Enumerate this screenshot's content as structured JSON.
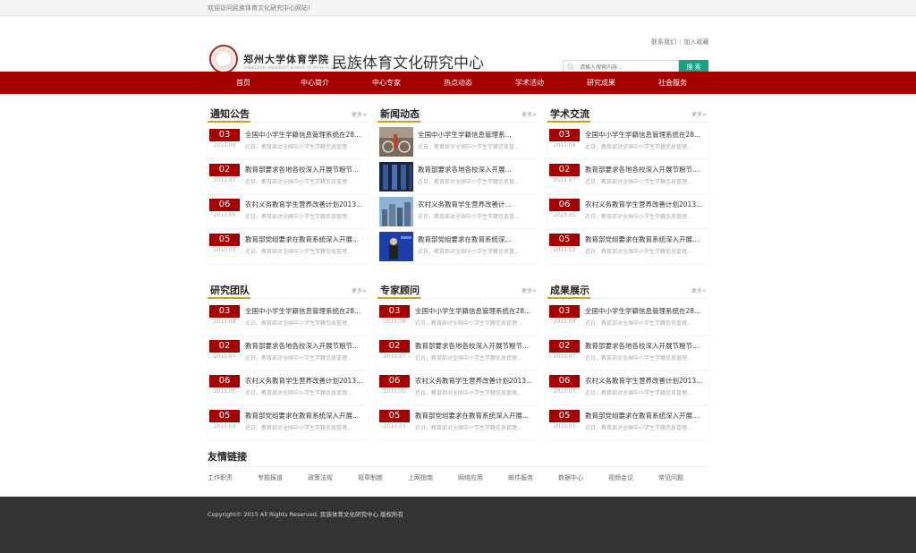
{
  "topbar": {
    "welcome": "欢迎访问民族体育文化研究中心网站!"
  },
  "header": {
    "logo_calligraphy": "郑州大学体育学院",
    "logo_sub": "ZHENGZHOU UNIVERSITY SCHOOL OF PHYSICAL EDUCATION",
    "site_title": "民族体育文化研究中心",
    "contact": "联系我们",
    "favorite": "加入收藏",
    "search_placeholder": "请输入搜索内容...",
    "search_button": "搜 索"
  },
  "nav": [
    "首页",
    "中心简介",
    "中心专家",
    "热点动态",
    "学术活动",
    "研究成果",
    "社会服务"
  ],
  "more_label": "更多>",
  "sections": [
    {
      "title": "通知公告",
      "items": [
        {
          "day": "03",
          "ym": "2013.09",
          "title": "全国中小学生学籍信息管理系统在28...",
          "desc": "近日，教育部对全国中小学生学籍信息管理..."
        },
        {
          "day": "02",
          "ym": "2013.07",
          "title": "教育部要求各地各校深入开展节粮节...",
          "desc": "近日，教育部对全国中小学生学籍信息管理..."
        },
        {
          "day": "06",
          "ym": "2013.05",
          "title": "农村义务教育学生营养改善计划2013...",
          "desc": "近日，教育部对全国中小学生学籍信息管理..."
        },
        {
          "day": "05",
          "ym": "2013.03",
          "title": "教育部党组要求在教育系统深入开展...",
          "desc": "近日，教育部对全国中小学生学籍信息管理..."
        }
      ]
    },
    {
      "title": "新闻动态",
      "items": [
        {
          "thumb": "bikes",
          "title": "全国中小学生学籍信息管理系...",
          "desc": "近日，教育部对全国中小学生学籍信息管..."
        },
        {
          "thumb": "servers",
          "title": "教育部要求各地各校深入开展...",
          "desc": "近日，教育部对全国中小学生学籍信息管..."
        },
        {
          "thumb": "city",
          "title": "农村义务教育学生营养改善计...",
          "desc": "近日，教育部对全国中小学生学籍信息管..."
        },
        {
          "thumb": "speaker",
          "title": "教育部党组要求在教育系统深...",
          "desc": "近日，教育部对全国中小学生学籍信息管..."
        }
      ]
    },
    {
      "title": "学术交流",
      "items": [
        {
          "day": "03",
          "ym": "2013.09",
          "title": "全国中小学生学籍信息管理系统在28...",
          "desc": "近日，教育部对全国中小学生学籍信息管理..."
        },
        {
          "day": "02",
          "ym": "2013.07",
          "title": "教育部要求各地各校深入开展节粮节...",
          "desc": "近日，教育部对全国中小学生学籍信息管理..."
        },
        {
          "day": "06",
          "ym": "2013.05",
          "title": "农村义务教育学生营养改善计划2013...",
          "desc": "近日，教育部对全国中小学生学籍信息管理..."
        },
        {
          "day": "05",
          "ym": "2013.03",
          "title": "教育部党组要求在教育系统深入开展...",
          "desc": "近日，教育部对全国中小学生学籍信息管理..."
        }
      ]
    },
    {
      "title": "研究团队",
      "items": [
        {
          "day": "03",
          "ym": "2013.09",
          "title": "全国中小学生学籍信息管理系统在28...",
          "desc": "近日，教育部对全国中小学生学籍信息管理..."
        },
        {
          "day": "02",
          "ym": "2013.07",
          "title": "教育部要求各地各校深入开展节粮节...",
          "desc": "近日，教育部对全国中小学生学籍信息管理..."
        },
        {
          "day": "06",
          "ym": "2013.05",
          "title": "农村义务教育学生营养改善计划2013...",
          "desc": "近日，教育部对全国中小学生学籍信息管理..."
        },
        {
          "day": "05",
          "ym": "2013.03",
          "title": "教育部党组要求在教育系统深入开展...",
          "desc": "近日，教育部对全国中小学生学籍信息管理..."
        }
      ]
    },
    {
      "title": "专家顾问",
      "items": [
        {
          "day": "03",
          "ym": "2013.09",
          "title": "全国中小学生学籍信息管理系统在28...",
          "desc": "近日，教育部对全国中小学生学籍信息管理..."
        },
        {
          "day": "02",
          "ym": "2013.07",
          "title": "教育部要求各地各校深入开展节粮节...",
          "desc": "近日，教育部对全国中小学生学籍信息管理..."
        },
        {
          "day": "06",
          "ym": "2013.05",
          "title": "农村义务教育学生营养改善计划2013...",
          "desc": "近日，教育部对全国中小学生学籍信息管理..."
        },
        {
          "day": "05",
          "ym": "2013.03",
          "title": "教育部党组要求在教育系统深入开展...",
          "desc": "近日，教育部对全国中小学生学籍信息管理..."
        }
      ]
    },
    {
      "title": "成果展示",
      "items": [
        {
          "day": "03",
          "ym": "2013.09",
          "title": "全国中小学生学籍信息管理系统在28...",
          "desc": "近日，教育部对全国中小学生学籍信息管理..."
        },
        {
          "day": "02",
          "ym": "2013.07",
          "title": "教育部要求各地各校深入开展节粮节...",
          "desc": "近日，教育部对全国中小学生学籍信息管理..."
        },
        {
          "day": "06",
          "ym": "2013.05",
          "title": "农村义务教育学生营养改善计划2013...",
          "desc": "近日，教育部对全国中小学生学籍信息管理..."
        },
        {
          "day": "05",
          "ym": "2013.03",
          "title": "教育部党组要求在教育系统深入开展...",
          "desc": "近日，教育部对全国中小学生学籍信息管理..."
        }
      ]
    }
  ],
  "links": {
    "title": "友情链接",
    "items": [
      "工作职责",
      "专题报道",
      "政策法规",
      "规章制度",
      "上网指南",
      "网络应用",
      "邮件服务",
      "数据中心",
      "视频会议",
      "常见问题"
    ]
  },
  "footer": {
    "copyright": "Copyright© 2015 All Rights Reserved. 民族体育文化研究中心 版权所有"
  },
  "colors": {
    "brand_red": "#a50000",
    "search_green": "#16a085",
    "accent_gold": "#d4a017",
    "footer_bg": "#333333"
  }
}
